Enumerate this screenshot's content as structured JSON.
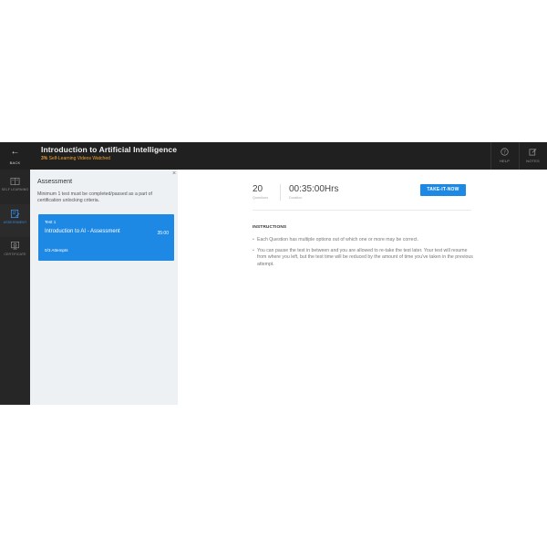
{
  "header": {
    "back_label": "BACK",
    "course_title": "Introduction to Artificial Intelligence",
    "progress_pct": "3%",
    "progress_text": "Self-Learning Videos Watched",
    "help_label": "HELP",
    "notes_label": "NOTES"
  },
  "sidebar": {
    "items": [
      {
        "label": "SELF LEARNING",
        "icon": "book-icon",
        "active": false
      },
      {
        "label": "ASSESSMENT",
        "icon": "assessment-icon",
        "active": true
      },
      {
        "label": "CERTIFICATE",
        "icon": "certificate-icon",
        "active": false
      }
    ]
  },
  "panel": {
    "title": "Assessment",
    "description": "Minimum 1 test must be completed/passed as a part of certification unlocking criteria.",
    "test_card": {
      "number": "Test 1",
      "name": "Introduction to AI - Assessment",
      "duration": "35:00",
      "attempts": "0/3 Attempts"
    }
  },
  "main": {
    "questions_count": "20",
    "questions_label": "Questions",
    "duration_value": "00:35:00Hrs",
    "duration_label": "Duration",
    "take_button": "TAKE-IT-NOW",
    "instructions_heading": "INSTRUCTIONS",
    "instructions": [
      "Each Question has multiple options out of which one or more may be correct.",
      "You can pause the test in between and you are allowed to re-take the test later. Your test will resume from where you left, but the test time will be reduced by the amount of time you've taken in the previous attempt."
    ]
  },
  "colors": {
    "accent": "#1e88e5",
    "topbar": "#202020",
    "progress": "#f0a030",
    "panel_bg": "#eef1f4"
  }
}
